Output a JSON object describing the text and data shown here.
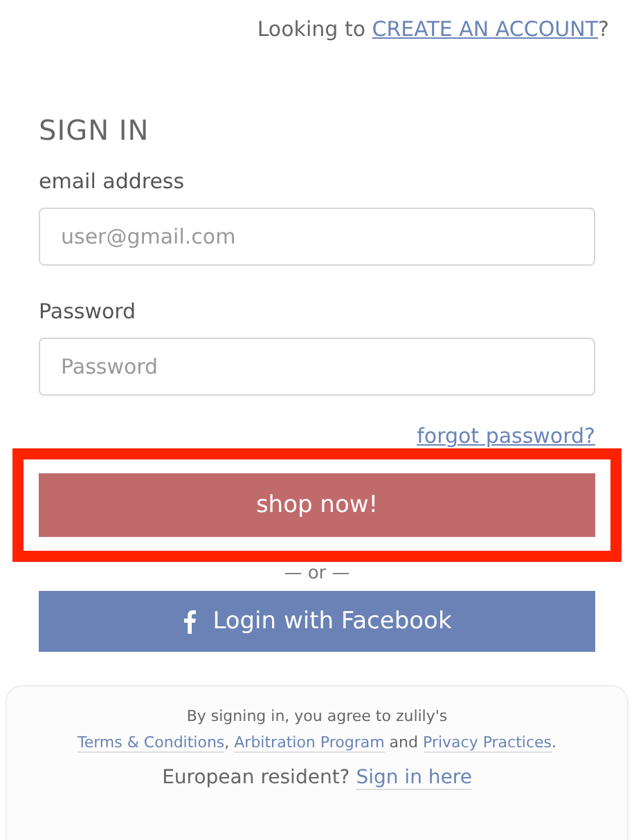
{
  "header": [
    {
      "kind": "text",
      "text": "Looking to "
    },
    {
      "kind": "link",
      "text": "CREATE AN ACCOUNT"
    },
    {
      "kind": "text",
      "text": "?"
    }
  ],
  "title": "SIGN IN",
  "fields": [
    {
      "label": "email address",
      "placeholder": "user@gmail.com"
    },
    {
      "label": "Password",
      "placeholder": "Password"
    }
  ],
  "forgot_link": "forgot password?",
  "submit": {
    "label": "shop now!",
    "highlighted": true
  },
  "divider": "— or —",
  "facebook_button": "Login with Facebook",
  "legal": [
    {
      "kind": "text",
      "text": "By signing in, you agree to zulily's"
    },
    {
      "kind": "break"
    },
    {
      "kind": "link",
      "text": "Terms & Conditions"
    },
    {
      "kind": "text",
      "text": ", "
    },
    {
      "kind": "link",
      "text": "Arbitration Program"
    },
    {
      "kind": "text",
      "text": " and "
    },
    {
      "kind": "link",
      "text": "Privacy Practices"
    },
    {
      "kind": "text",
      "text": "."
    }
  ],
  "eu_notice": [
    {
      "kind": "text",
      "text": "European resident? "
    },
    {
      "kind": "link",
      "text": "Sign in here"
    }
  ]
}
